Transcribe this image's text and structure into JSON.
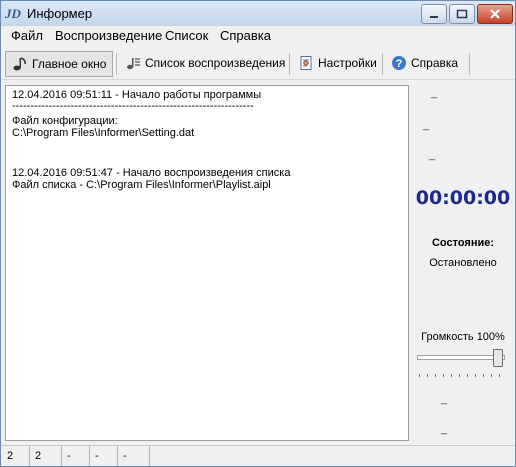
{
  "window": {
    "title": "Информер"
  },
  "menu": [
    "Файл",
    "Воспроизведение",
    "Список",
    "Справка"
  ],
  "tabs": [
    {
      "label": "Главное окно",
      "icon": "music-note-icon",
      "active": true
    },
    {
      "label": "Список воспроизведения",
      "icon": "playlist-icon",
      "active": false
    },
    {
      "label": "Настройки",
      "icon": "settings-document-icon",
      "active": false
    },
    {
      "label": "Справка",
      "icon": "help-icon",
      "active": false
    }
  ],
  "log": {
    "lines": [
      "12.04.2016 09:51:11 - Начало работы программы",
      "------------------------------------------------------------------",
      "Файл конфигурации:",
      "C:\\Program Files\\Informer\\Setting.dat",
      "",
      "12.04.2016 09:51:47 - Начало воспроизведения списка",
      "Файл списка - C:\\Program Files\\Informer\\Playlist.aipl"
    ]
  },
  "side": {
    "dash_top": "_",
    "dash_mid": "_",
    "dash_low": "_",
    "timer": "00:00:00",
    "state_label": "Состояние:",
    "state_value": "Остановлено",
    "volume_label": "Громкость 100%",
    "volume_value": 100,
    "dash_bottom_1": "_",
    "dash_bottom_2": "_"
  },
  "status": [
    "2",
    "2",
    "-",
    "-",
    "-"
  ]
}
